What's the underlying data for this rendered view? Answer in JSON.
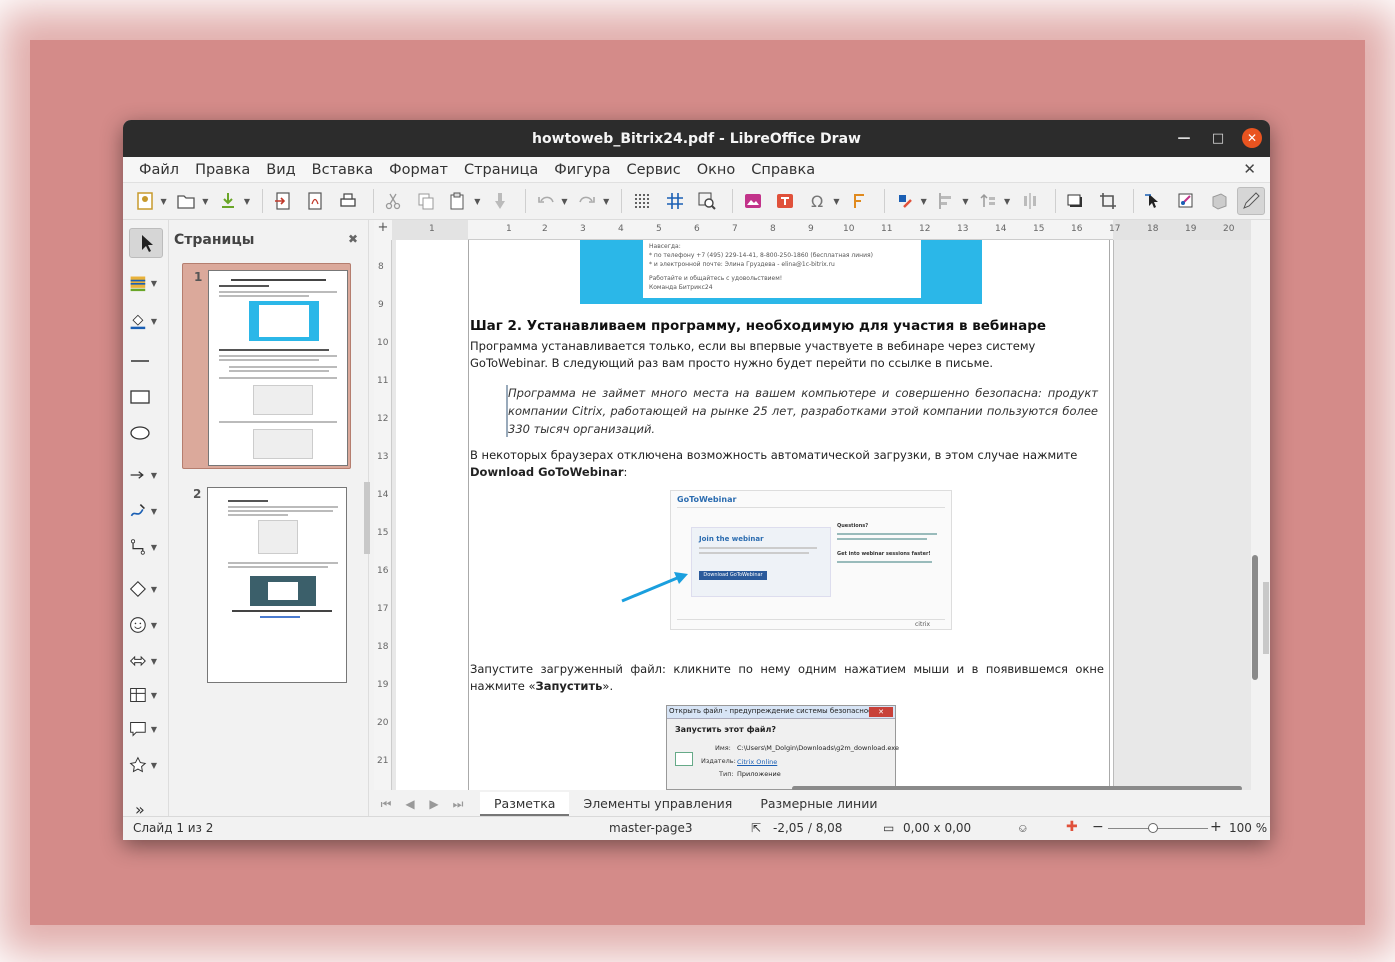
{
  "window": {
    "title": "howtoweb_Bitrix24.pdf - LibreOffice Draw"
  },
  "menu": [
    "Файл",
    "Правка",
    "Вид",
    "Вставка",
    "Формат",
    "Страница",
    "Фигура",
    "Сервис",
    "Окно",
    "Справка"
  ],
  "pages_panel": {
    "title": "Страницы",
    "pages": [
      {
        "number": "1",
        "selected": true
      },
      {
        "number": "2",
        "selected": false
      }
    ]
  },
  "ruler": {
    "h": [
      "1",
      "1",
      "2",
      "3",
      "4",
      "5",
      "6",
      "7",
      "8",
      "9",
      "10",
      "11",
      "12",
      "13",
      "14",
      "15",
      "16",
      "17",
      "18",
      "19",
      "20"
    ],
    "v": [
      "8",
      "9",
      "10",
      "11",
      "12",
      "13",
      "14",
      "15",
      "16",
      "17",
      "18",
      "19",
      "20",
      "21"
    ]
  },
  "document": {
    "img1_lines": [
      "Навсегда:",
      "* по телефону +7 (495) 229-14-41, 8-800-250-1860 (бесплатная линия)",
      "* и электронной почте: Элина Груздева - elina@1c-bitrix.ru",
      "",
      "Работайте и общайтесь с удовольствием!",
      "Команда Битрикс24"
    ],
    "heading": "Шаг 2. Устанавливаем программу, необходимую для участия в вебинаре",
    "para1": "Программа устанавливается только, если вы впервые участвуете в вебинаре через систему  GoToWebinar. В следующий раз вам просто нужно будет перейти по ссылке в письме.",
    "quote": "Программа не займет много места на вашем компьютере и совершенно безопасна: продукт компании Citrix, работающей на рынке 25 лет, разработками этой компании пользуются более 330 тысяч организаций.",
    "para2_start": "В некоторых браузерах отключена возможность автоматической загрузки, в этом случае нажмите ",
    "para2_bold": "Download GoToWebinar",
    "para2_end": ":",
    "gtw": {
      "logo": "GoToWebinar",
      "join": "Join the webinar",
      "button": "Download GoToWebinar",
      "questions": "Questions?",
      "faster": "Get into webinar sessions faster!",
      "brand": "citrix"
    },
    "para3_start": "Запустите загруженный файл: кликните по нему одним нажатием мыши и в появившемся окне нажмите «",
    "para3_bold": "Запустить",
    "para3_end": "».",
    "dialog": {
      "title": "Открыть файл - предупреждение системы безопасности",
      "question": "Запустить этот файл?",
      "name_label": "Имя:",
      "name_value": "C:\\Users\\M_Dolgin\\Downloads\\g2m_download.exe",
      "publisher_label": "Издатель:",
      "publisher_value": "Citrix Online",
      "type_label": "Тип:",
      "type_value": "Приложение"
    }
  },
  "tabs": [
    "Разметка",
    "Элементы управления",
    "Размерные линии"
  ],
  "status": {
    "slide": "Слайд 1 из 2",
    "master": "master-page3",
    "position": "-2,05 / 8,08",
    "size": "0,00 x 0,00",
    "zoom": "100 %"
  },
  "colors": {
    "titlebar": "#2c2c2c",
    "close_button": "#e95420",
    "selected_thumb": "#dba99b",
    "backdrop": "#d48b89",
    "email_banner": "#2bb7e8"
  }
}
